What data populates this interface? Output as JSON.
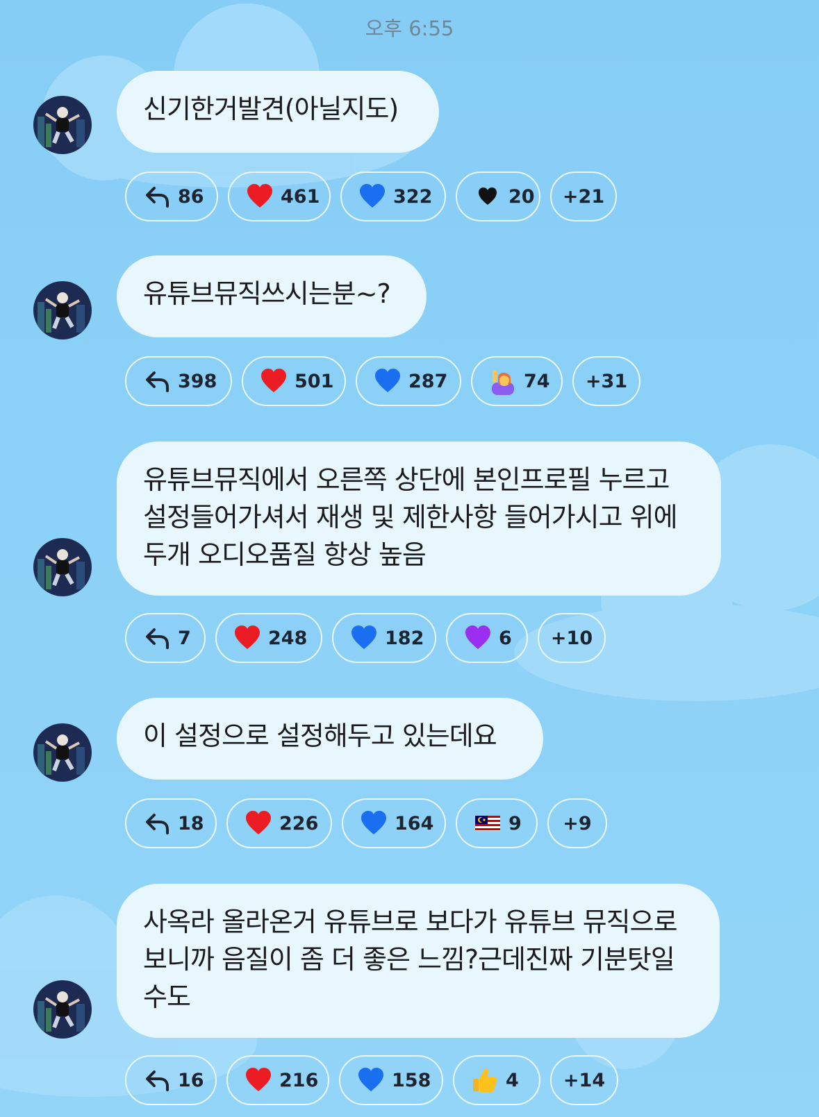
{
  "timestamp": "오후 6:55",
  "colors": {
    "background": "#8ed1f7",
    "bubble": "#e8f7fe",
    "chip_border": "#e9f7ff",
    "red_heart": "#ec1c24",
    "blue_heart": "#1a6ff0",
    "purple_heart": "#9b2ff0"
  },
  "messages": [
    {
      "text": "신기한거발견(아닐지도)",
      "reactions": [
        {
          "icon": "reply-icon",
          "count": "86"
        },
        {
          "icon": "red-heart-icon",
          "count": "461"
        },
        {
          "icon": "blue-heart-icon",
          "count": "322"
        },
        {
          "icon": "black-heart-icon",
          "count": "20"
        },
        {
          "icon": "",
          "count": "+21"
        }
      ]
    },
    {
      "text": "유튜브뮤직쓰시는분~?",
      "reactions": [
        {
          "icon": "reply-icon",
          "count": "398"
        },
        {
          "icon": "red-heart-icon",
          "count": "501"
        },
        {
          "icon": "blue-heart-icon",
          "count": "287"
        },
        {
          "icon": "raising-hand-icon",
          "count": "74"
        },
        {
          "icon": "",
          "count": "+31"
        }
      ]
    },
    {
      "text": "유튜브뮤직에서 오른쪽 상단에 본인프로필 누르고 설정들어가셔서 재생 및 제한사항 들어가시고 위에 두개 오디오품질 항상 높음",
      "reactions": [
        {
          "icon": "reply-icon",
          "count": "7"
        },
        {
          "icon": "red-heart-icon",
          "count": "248"
        },
        {
          "icon": "blue-heart-icon",
          "count": "182"
        },
        {
          "icon": "purple-heart-icon",
          "count": "6"
        },
        {
          "icon": "",
          "count": "+10"
        }
      ]
    },
    {
      "text": "이 설정으로 설정해두고 있는데요",
      "reactions": [
        {
          "icon": "reply-icon",
          "count": "18"
        },
        {
          "icon": "red-heart-icon",
          "count": "226"
        },
        {
          "icon": "blue-heart-icon",
          "count": "164"
        },
        {
          "icon": "malaysia-flag-icon",
          "count": "9"
        },
        {
          "icon": "",
          "count": "+9"
        }
      ]
    },
    {
      "text": "사옥라 올라온거 유튜브로 보다가 유튜브 뮤직으로 보니까 음질이 좀 더 좋은 느낌?근데진짜 기분탓일수도",
      "reactions": [
        {
          "icon": "reply-icon",
          "count": "16"
        },
        {
          "icon": "red-heart-icon",
          "count": "216"
        },
        {
          "icon": "blue-heart-icon",
          "count": "158"
        },
        {
          "icon": "thumbs-up-icon",
          "count": "4"
        },
        {
          "icon": "",
          "count": "+14"
        }
      ]
    }
  ]
}
